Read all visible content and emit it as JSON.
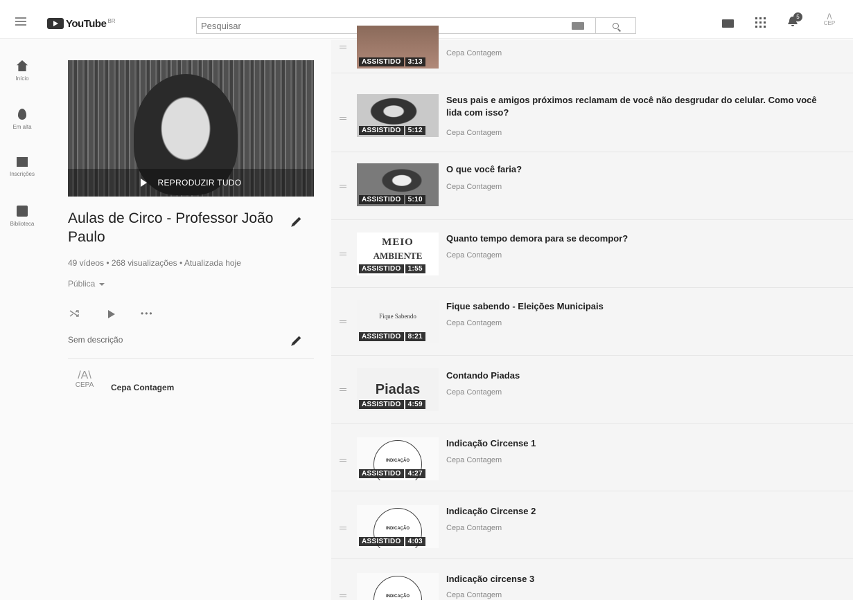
{
  "header": {
    "logo_text": "YouTube",
    "logo_country": "BR",
    "search_placeholder": "Pesquisar",
    "notification_count": "5",
    "avatar_text": "CEP"
  },
  "sidebar": {
    "items": [
      {
        "label": "Início",
        "icon": "home-icon"
      },
      {
        "label": "Em alta",
        "icon": "fire-icon"
      },
      {
        "label": "Inscrições",
        "icon": "subscriptions-icon"
      },
      {
        "label": "Biblioteca",
        "icon": "library-icon"
      }
    ]
  },
  "playlist": {
    "play_all_label": "REPRODUZIR TUDO",
    "title": "Aulas de Circo - Professor João Paulo",
    "stats": "49 vídeos • 268 visualizações • Atualizada hoje",
    "privacy": "Pública",
    "description": "Sem descrição",
    "owner_name": "Cepa Contagem",
    "owner_logo_text": "CEPA"
  },
  "videos": [
    {
      "title": "",
      "channel": "Cepa Contagem",
      "watched": "ASSISTIDO",
      "duration": "3:13"
    },
    {
      "title": "Seus pais e amigos próximos reclamam de você não desgrudar do celular. Como você lida com isso?",
      "channel": "Cepa Contagem",
      "watched": "ASSISTIDO",
      "duration": "5:12"
    },
    {
      "title": "O que você faria?",
      "channel": "Cepa Contagem",
      "watched": "ASSISTIDO",
      "duration": "5:10"
    },
    {
      "title": "Quanto tempo demora para se decompor?",
      "channel": "Cepa Contagem",
      "watched": "ASSISTIDO",
      "duration": "1:55",
      "thumb_text_1": "MEIO",
      "thumb_text_2": "AMBIENTE"
    },
    {
      "title": "Fique sabendo - Eleições Municipais",
      "channel": "Cepa Contagem",
      "watched": "ASSISTIDO",
      "duration": "8:21",
      "thumb_text_1": "Fique Sabendo"
    },
    {
      "title": "Contando Piadas",
      "channel": "Cepa Contagem",
      "watched": "ASSISTIDO",
      "duration": "4:59",
      "thumb_text_1": "Piadas"
    },
    {
      "title": "Indicação Circense 1",
      "channel": "Cepa Contagem",
      "watched": "ASSISTIDO",
      "duration": "4:27",
      "thumb_text_1": "INDICAÇÃO"
    },
    {
      "title": "Indicação Circense 2",
      "channel": "Cepa Contagem",
      "watched": "ASSISTIDO",
      "duration": "4:03",
      "thumb_text_1": "INDICAÇÃO"
    },
    {
      "title": "Indicação circense 3",
      "channel": "Cepa Contagem",
      "watched": "",
      "duration": "",
      "thumb_text_1": "INDICAÇÃO"
    }
  ]
}
